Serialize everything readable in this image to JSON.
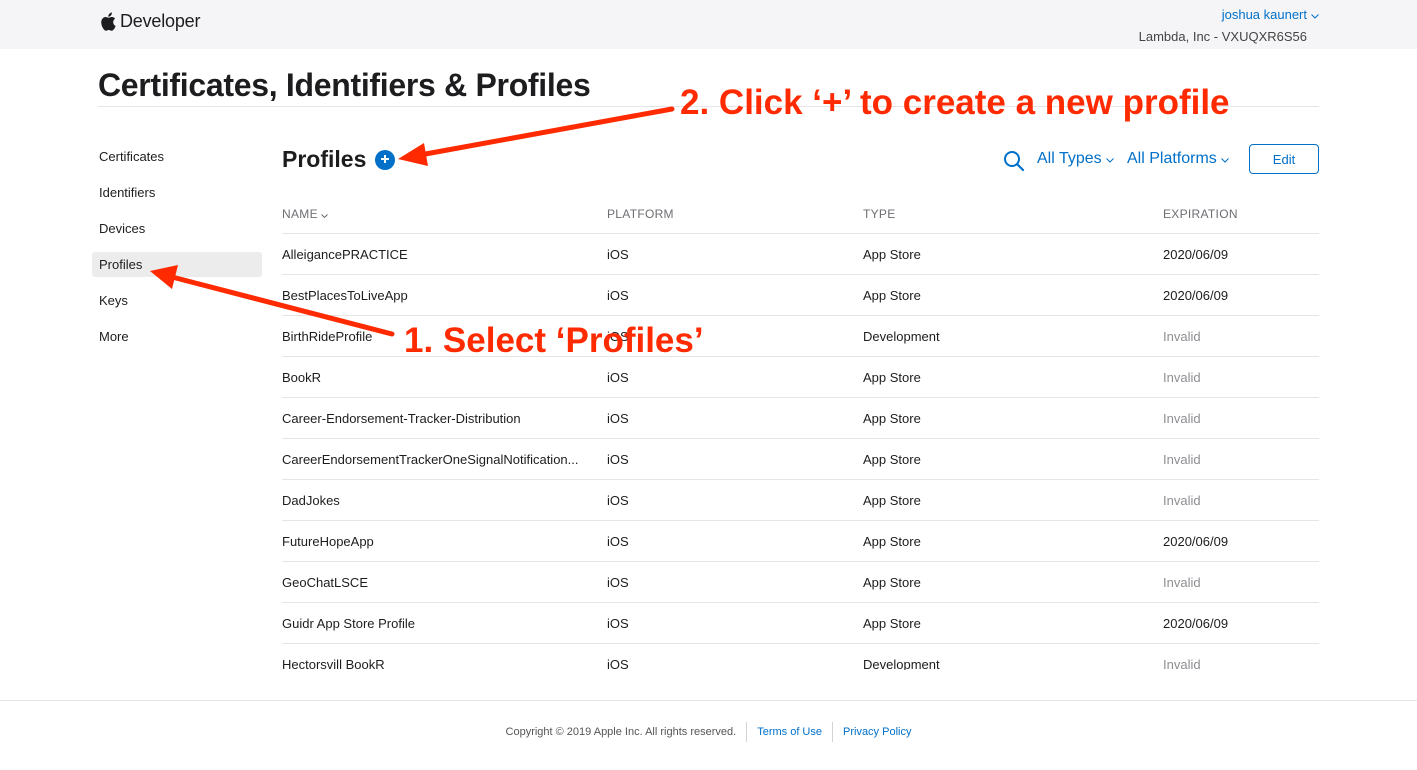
{
  "header": {
    "logo_text": "Developer",
    "account_name": "joshua kaunert",
    "account_team": "Lambda, Inc - VXUQXR6S56"
  },
  "page": {
    "title": "Certificates, Identifiers & Profiles"
  },
  "sidebar": {
    "items": [
      {
        "label": "Certificates",
        "active": false
      },
      {
        "label": "Identifiers",
        "active": false
      },
      {
        "label": "Devices",
        "active": false
      },
      {
        "label": "Profiles",
        "active": true
      },
      {
        "label": "Keys",
        "active": false
      },
      {
        "label": "More",
        "active": false
      }
    ]
  },
  "content": {
    "title": "Profiles",
    "filter_types": "All Types",
    "filter_platforms": "All Platforms",
    "edit_label": "Edit"
  },
  "table": {
    "columns": [
      "NAME",
      "PLATFORM",
      "TYPE",
      "EXPIRATION"
    ],
    "rows": [
      {
        "name": "AlleigancePRACTICE",
        "platform": "iOS",
        "type": "App Store",
        "expiration": "2020/06/09"
      },
      {
        "name": "BestPlacesToLiveApp",
        "platform": "iOS",
        "type": "App Store",
        "expiration": "2020/06/09"
      },
      {
        "name": "BirthRideProfile",
        "platform": "iOS",
        "type": "Development",
        "expiration": "Invalid"
      },
      {
        "name": "BookR",
        "platform": "iOS",
        "type": "App Store",
        "expiration": "Invalid"
      },
      {
        "name": "Career-Endorsement-Tracker-Distribution",
        "platform": "iOS",
        "type": "App Store",
        "expiration": "Invalid"
      },
      {
        "name": "CareerEndorsementTrackerOneSignalNotification...",
        "platform": "iOS",
        "type": "App Store",
        "expiration": "Invalid"
      },
      {
        "name": "DadJokes",
        "platform": "iOS",
        "type": "App Store",
        "expiration": "Invalid"
      },
      {
        "name": "FutureHopeApp",
        "platform": "iOS",
        "type": "App Store",
        "expiration": "2020/06/09"
      },
      {
        "name": "GeoChatLSCE",
        "platform": "iOS",
        "type": "App Store",
        "expiration": "Invalid"
      },
      {
        "name": "Guidr App Store Profile",
        "platform": "iOS",
        "type": "App Store",
        "expiration": "2020/06/09"
      },
      {
        "name": "Hectorsvill BookR",
        "platform": "iOS",
        "type": "Development",
        "expiration": "Invalid"
      }
    ]
  },
  "footer": {
    "copyright": "Copyright © 2019 Apple Inc. All rights reserved.",
    "terms": "Terms of Use",
    "privacy": "Privacy Policy"
  },
  "annotations": {
    "step2": "2. Click ‘+’ to create a new profile",
    "step1": "1. Select ‘Profiles’"
  },
  "colors": {
    "accent": "#0070c9",
    "annotation": "#ff2a00",
    "invalid": "#8e8e93"
  },
  "icons": [
    "apple-logo-icon",
    "chevron-down-icon",
    "plus-icon",
    "search-icon",
    "arrow-icon"
  ]
}
